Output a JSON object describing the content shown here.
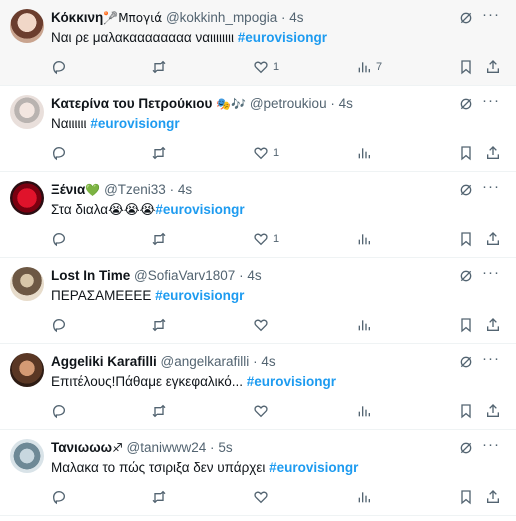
{
  "colors": {
    "hashtag": "#1d9bf0",
    "muted": "#536471",
    "text": "#0f1419"
  },
  "tweets": [
    {
      "name": "Κόκκινη",
      "name_suffix": "🥍Μπογιά",
      "handle": "@kokkinh_mpogia",
      "time": "4s",
      "text": "Ναι ρε μαλακαααααααα ναιιιιιιιι ",
      "hashtag": "#eurovisiongr",
      "likes": "1",
      "views": "7",
      "avatar": "avatar-portrait"
    },
    {
      "name": "Κατερίνα του Πετρούκιου",
      "name_suffix": " 🎭🎶",
      "handle": "@petroukiou",
      "time": "4s",
      "text": "Ναιιιιιι ",
      "hashtag": "#eurovisiongr",
      "likes": "1",
      "views": "",
      "avatar": "avatar-sketch"
    },
    {
      "name": "Ξένια",
      "name_suffix": "💚",
      "handle": "@Tzeni33",
      "time": "4s",
      "text": "Στα διαλα😭😭😭",
      "hashtag": "#eurovisiongr",
      "likes": "1",
      "views": "",
      "avatar": "avatar-red-heart"
    },
    {
      "name": "Lost In Time",
      "name_suffix": "",
      "handle": "@SofiaVarv1807",
      "time": "4s",
      "text": "ΠΕΡΑΣΑΜΕΕΕΕ ",
      "hashtag": "#eurovisiongr",
      "likes": "",
      "views": "",
      "avatar": "avatar-figure"
    },
    {
      "name": "Aggeliki Karafilli",
      "name_suffix": "",
      "handle": "@angelkarafilli",
      "time": "4s",
      "text": "Επιτέλους!Πάθαμε εγκεφαλικό... ",
      "hashtag": "#eurovisiongr",
      "likes": "",
      "views": "",
      "avatar": "avatar-woman"
    },
    {
      "name": "Τανιωωω",
      "name_suffix": "♐",
      "handle": "@taniwww24",
      "time": "5s",
      "text": "Μαλακα το πώς τσιριξα δεν υπάρχει ",
      "hashtag": "#eurovisiongr",
      "likes": "",
      "views": "",
      "avatar": "avatar-group"
    }
  ]
}
